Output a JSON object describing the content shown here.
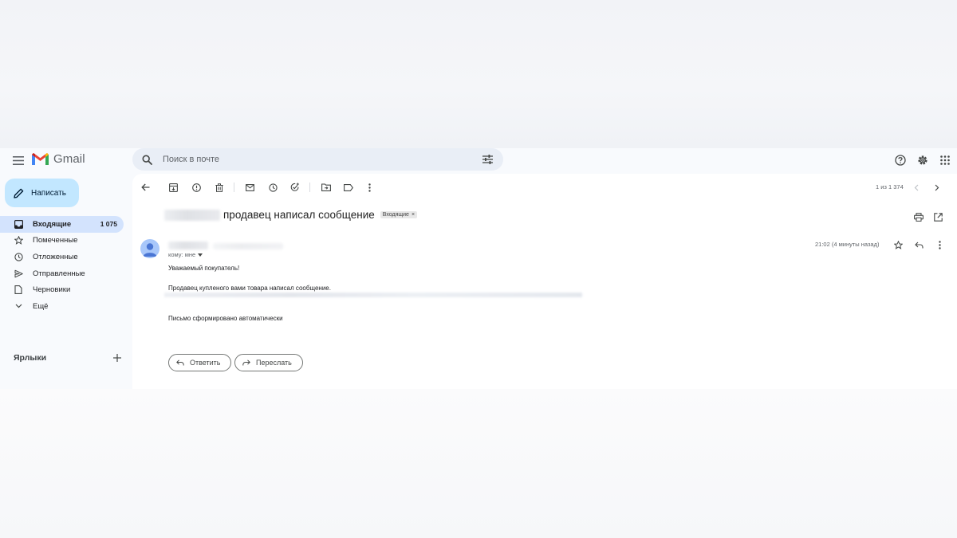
{
  "app": {
    "name": "Gmail"
  },
  "search": {
    "placeholder": "Поиск в почте"
  },
  "sidebar": {
    "compose_label": "Написать",
    "items": [
      {
        "label": "Входящие",
        "count": "1 075",
        "icon": "inbox-icon",
        "active": true
      },
      {
        "label": "Помеченные",
        "icon": "star-icon"
      },
      {
        "label": "Отложенные",
        "icon": "clock-icon"
      },
      {
        "label": "Отправленные",
        "icon": "send-icon"
      },
      {
        "label": "Черновики",
        "icon": "draft-icon"
      },
      {
        "label": "Ещё",
        "icon": "chevron-down-icon"
      }
    ],
    "labels_title": "Ярлыки"
  },
  "toolbar": {
    "pager": "1 из 1 374"
  },
  "message": {
    "subject": "продавец написал сообщение",
    "label_chip": "Входящие",
    "to": "кому: мне",
    "time": "21:02 (4 минуты назад)",
    "greeting": "Уважаемый покупатель!",
    "line1": "Продавец купленого вами товара написал сообщение.",
    "footer": "Письмо сформировано автоматически"
  },
  "actions": {
    "reply": "Ответить",
    "forward": "Переслать"
  },
  "colors": {
    "compose_bg": "#c2e7ff",
    "active_nav": "#d3e3fd",
    "search_bg": "#e9eef6",
    "avatar": "#a8c7fa"
  }
}
